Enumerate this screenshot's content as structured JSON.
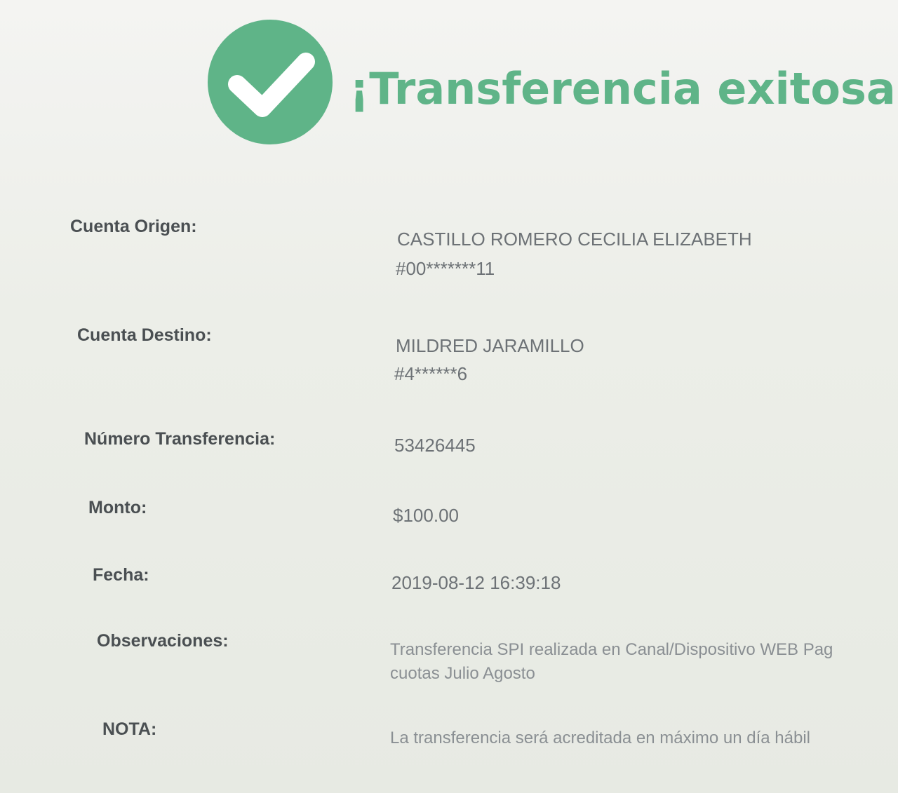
{
  "header": {
    "title": "¡Transferencia exitosa!",
    "icon": "check-circle-icon",
    "accent_color": "#5fb488"
  },
  "fields": {
    "cuenta_origen": {
      "label": "Cuenta Origen:",
      "name": "CASTILLO ROMERO CECILIA ELIZABETH",
      "account": "#00*******11"
    },
    "cuenta_destino": {
      "label": "Cuenta Destino:",
      "name": "MILDRED JARAMILLO",
      "account": "#4******6"
    },
    "numero_transferencia": {
      "label": "Número Transferencia:",
      "value": "53426445"
    },
    "monto": {
      "label": "Monto:",
      "value": "$100.00"
    },
    "fecha": {
      "label": "Fecha:",
      "value": "2019-08-12 16:39:18"
    },
    "observaciones": {
      "label": "Observaciones:",
      "line1": "Transferencia SPI realizada en Canal/Dispositivo WEB Pag",
      "line2": "cuotas Julio Agosto"
    },
    "nota": {
      "label": "NOTA:",
      "value": "La transferencia será acreditada en máximo un día hábil"
    }
  }
}
